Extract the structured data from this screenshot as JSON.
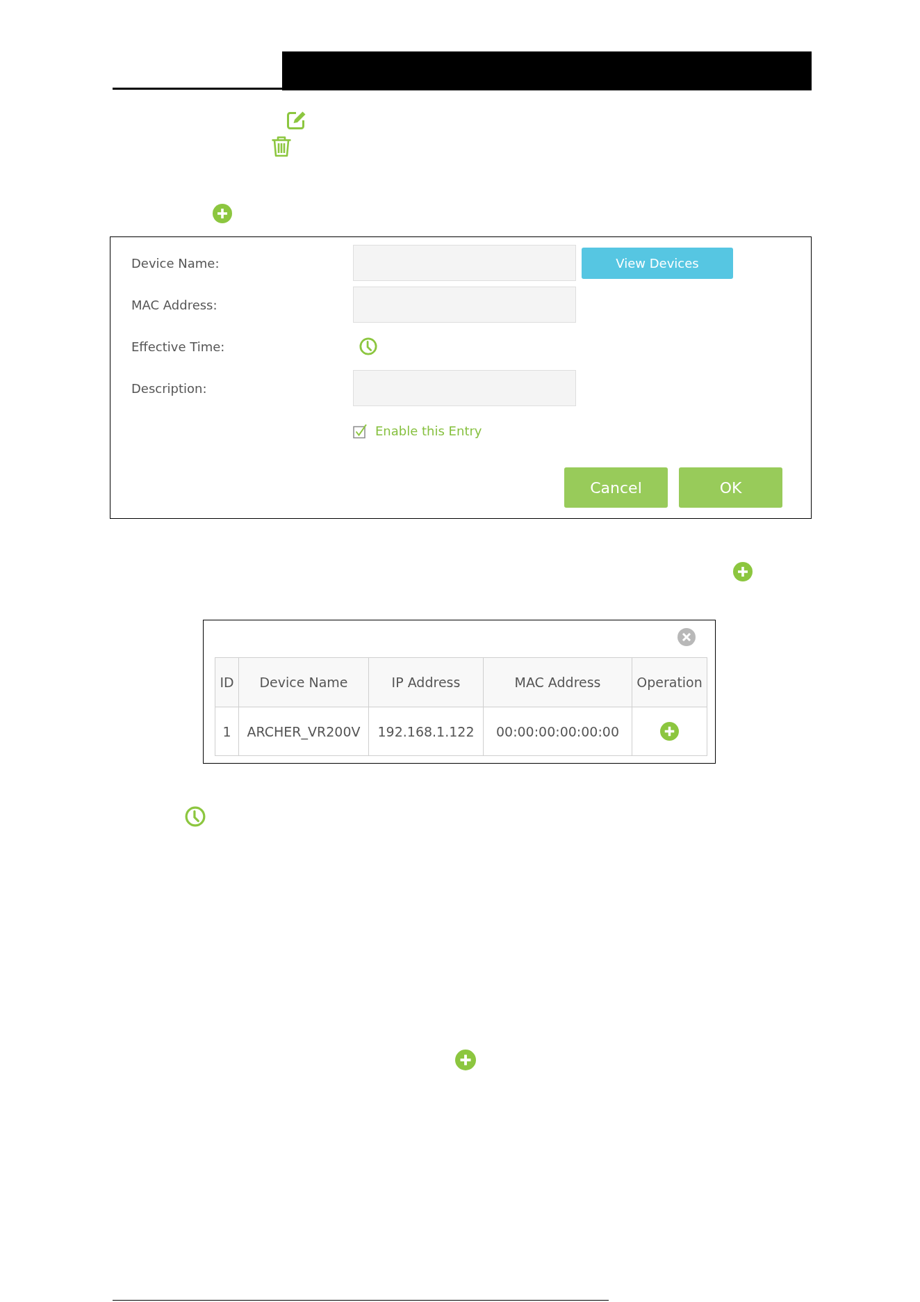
{
  "form": {
    "fields": [
      {
        "kind": "text",
        "label": "Device Name:",
        "button": "View Devices"
      },
      {
        "kind": "text",
        "label": "MAC Address:"
      },
      {
        "kind": "time",
        "label": "Effective Time:"
      },
      {
        "kind": "text",
        "label": "Description:"
      }
    ],
    "enable_entry": {
      "label": "Enable this Entry",
      "checked": true
    },
    "buttons": [
      "Cancel",
      "OK"
    ]
  },
  "device_dialog": {
    "table": {
      "columns": [
        "ID",
        "Device Name",
        "IP Address",
        "MAC Address",
        "Operation"
      ],
      "rows": [
        {
          "cells": [
            "1",
            "ARCHER_VR200V",
            "192.168.1.122",
            "00:00:00:00:00:00"
          ]
        }
      ]
    }
  }
}
